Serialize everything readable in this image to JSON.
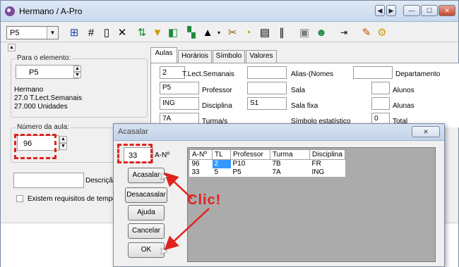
{
  "window": {
    "title": "Hermano / A-Pro"
  },
  "toolbar": {
    "combo_value": "P5"
  },
  "left_panel": {
    "element_group_label": "Para o elemento:",
    "element_value": "P5",
    "info_name": "Hermano",
    "info_line1": "27.0 T.Lect.Semanais",
    "info_line2": "27.000 Unidades",
    "lesson_group_label": "Número da aula:",
    "lesson_value": "96",
    "description_label": "Descriçã",
    "requirements_label": "Existem requisitos de tempo"
  },
  "tabs": [
    "Aulas",
    "Horários",
    "Símbolo",
    "Valores"
  ],
  "tab_fields": {
    "lect_value": "2",
    "lect_label": "T.Lect.Semanais",
    "prof_value": "P5",
    "prof_label": "Professor",
    "disc_value": "ING",
    "disc_label": "Disciplina",
    "turma_value": "7A",
    "turma_label": "Turma/s",
    "alias_label": "Alias-(Nomes",
    "dept_label": "Departamento",
    "sala_label": "Sala",
    "alunos_label": "Alunos",
    "salafixa_value": "S1",
    "salafixa_label": "Sala fixa",
    "alunas_label": "Alunas",
    "simbolo_label": "Símbolo estatístico",
    "total_value": "0",
    "total_label": "Total"
  },
  "dialog": {
    "title": "Acasalar",
    "an_value": "33",
    "an_label": "A-Nº",
    "buttons": {
      "acasalar": "Acasalar",
      "desacasalar": "Desacasalar",
      "ajuda": "Ajuda",
      "cancelar": "Cancelar",
      "ok": "OK"
    },
    "columns": [
      "A-Nº",
      "TL",
      "Professor",
      "Turma",
      "Disciplina"
    ],
    "rows": [
      [
        "96",
        "2",
        "P10",
        "7B",
        "FR"
      ],
      [
        "33",
        "5",
        "P5",
        "7A",
        "ING"
      ]
    ]
  },
  "annotation": {
    "text": "Clic!",
    "color": "#e0231e"
  }
}
